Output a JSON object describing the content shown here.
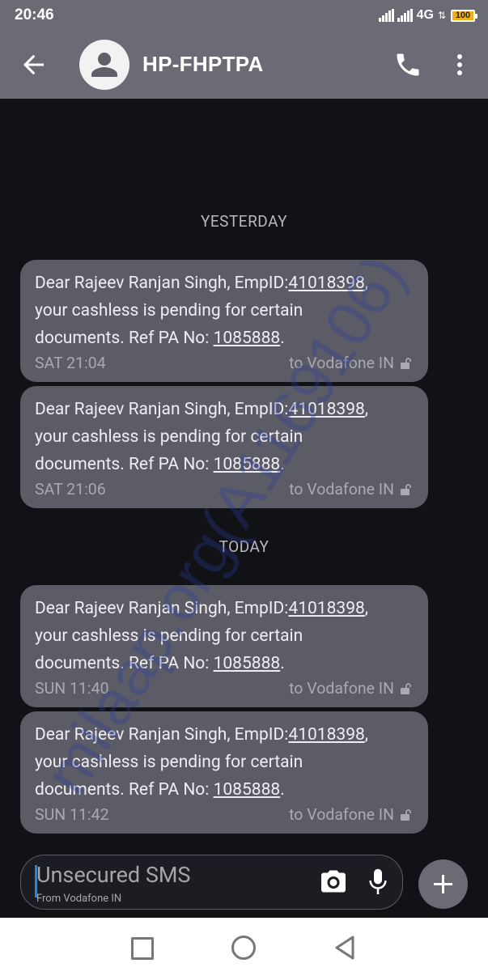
{
  "status_bar": {
    "time": "20:46",
    "network": "4G",
    "battery": "100"
  },
  "app_bar": {
    "title": "HP-FHPTPA"
  },
  "conversation": {
    "watermark": "milaap.org(A1169106)",
    "sections": [
      {
        "label": "YESTERDAY"
      },
      {
        "label": "TODAY"
      }
    ],
    "messages": [
      {
        "prefix": "Dear Rajeev Ranjan Singh, EmpID:",
        "emp_id": "41018398",
        "middle": ",\nyour cashless is pending for certain\ndocuments. Ref PA No: ",
        "ref_no": "1085888",
        "suffix": ".",
        "time": "SAT 21:04",
        "to": "to Vodafone IN"
      },
      {
        "prefix": "Dear Rajeev Ranjan Singh, EmpID:",
        "emp_id": "41018398",
        "middle": ",\nyour cashless is pending for certain\ndocuments. Ref PA No: ",
        "ref_no": "1085888",
        "suffix": ".",
        "time": "SAT 21:06",
        "to": "to Vodafone IN"
      },
      {
        "prefix": "Dear Rajeev Ranjan Singh, EmpID:",
        "emp_id": "41018398",
        "middle": ",\nyour cashless is pending for certain\ndocuments. Ref PA No: ",
        "ref_no": "1085888",
        "suffix": ".",
        "time": "SUN 11:40",
        "to": "to Vodafone IN"
      },
      {
        "prefix": "Dear Rajeev Ranjan Singh, EmpID:",
        "emp_id": "41018398",
        "middle": ",\nyour cashless is pending for certain\ndocuments. Ref PA No: ",
        "ref_no": "1085888",
        "suffix": ".",
        "time": "SUN 11:42",
        "to": "to Vodafone IN"
      }
    ]
  },
  "compose": {
    "placeholder": "Unsecured SMS",
    "sub_label": "From Vodafone IN"
  },
  "icons": {
    "back": "arrow-back-icon",
    "avatar": "person-icon",
    "call": "phone-icon",
    "more": "more-vert-icon",
    "camera": "camera-icon",
    "mic": "microphone-icon",
    "add": "plus-icon",
    "lock": "unlocked-padlock-icon"
  },
  "colors": {
    "app_bar": "#6b6b75",
    "background": "#111216",
    "bubble": "#5c5c66",
    "cursor": "#1e88e5",
    "watermark": "#2a3a9a",
    "battery": "#f0b01a"
  }
}
